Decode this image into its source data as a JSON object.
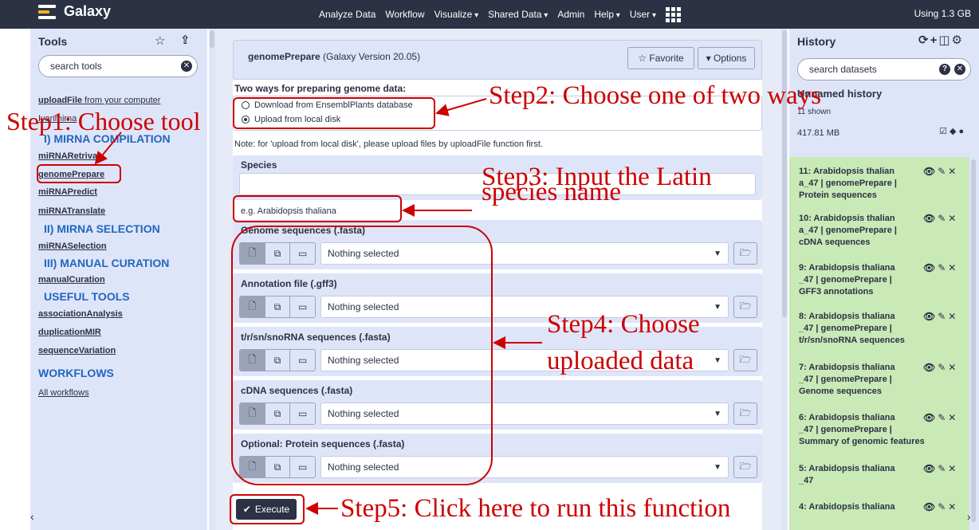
{
  "masthead": {
    "brand": "Galaxy",
    "nav": [
      "Analyze Data",
      "Workflow",
      "Visualize",
      "Shared Data",
      "Admin",
      "Help",
      "User"
    ],
    "quota": "Using 1.3 GB"
  },
  "tools_panel": {
    "title": "Tools",
    "search_placeholder": "search tools",
    "upload_link": "uploadFile",
    "upload_suffix": " from your computer",
    "group_title": "Ivanmirna",
    "sections": [
      {
        "title": "I) MIRNA COMPILATION",
        "tools": [
          "miRNARetrival",
          "genomePrepare",
          "miRNAPredict",
          "miRNATranslate"
        ]
      },
      {
        "title": "II) MIRNA SELECTION",
        "tools": [
          "miRNASelection"
        ]
      },
      {
        "title": "III) MANUAL CURATION",
        "tools": [
          "manualCuration"
        ]
      },
      {
        "title": "USEFUL TOOLS",
        "tools": [
          "associationAnalysis",
          "duplicationMIR",
          "sequenceVariation"
        ]
      }
    ],
    "workflows_title": "WORKFLOWS",
    "all_workflows": "All workflows"
  },
  "tool_form": {
    "tool_name": "genomePrepare",
    "tool_version": " (Galaxy Version 20.05)",
    "favorite_label": "Favorite",
    "options_label": "Options",
    "ways_label": "Two ways for preparing genome data:",
    "radio_options": [
      "Download from EnsemblPlants database",
      "Upload from local disk"
    ],
    "selected_radio": 1,
    "note": "Note: for 'upload from local disk', please upload files by uploadFile function first.",
    "species_label": "Species",
    "species_value": "",
    "species_help": "e.g. Arabidopsis thaliana",
    "datasets": [
      {
        "label": "Genome sequences (.fasta)",
        "value": "Nothing selected"
      },
      {
        "label": "Annotation file (.gff3)",
        "value": "Nothing selected"
      },
      {
        "label": "t/r/sn/snoRNA sequences (.fasta)",
        "value": "Nothing selected"
      },
      {
        "label": "cDNA sequences (.fasta)",
        "value": "Nothing selected"
      },
      {
        "label": "Optional: Protein sequences (.fasta)",
        "value": "Nothing selected"
      }
    ],
    "execute_label": "Execute"
  },
  "history": {
    "title": "History",
    "search_placeholder": "search datasets",
    "name": "Unnamed history",
    "shown": "11 shown",
    "size": "417.81 MB",
    "datasets": [
      {
        "line1": "11: Arabidopsis thalian",
        "line2": "a_47 | genomePrepare |",
        "line3": "Protein sequences"
      },
      {
        "line1": "10: Arabidopsis thalian",
        "line2": "a_47 | genomePrepare |",
        "line3": "cDNA sequences"
      },
      {
        "line1": "9: Arabidopsis thaliana",
        "line2": "_47 | genomePrepare |",
        "line3": "GFF3 annotations"
      },
      {
        "line1": "8: Arabidopsis thaliana",
        "line2": "_47 | genomePrepare |",
        "line3": "t/r/sn/snoRNA sequences"
      },
      {
        "line1": "7: Arabidopsis thaliana",
        "line2": "_47 | genomePrepare |",
        "line3": "Genome sequences"
      },
      {
        "line1": "6: Arabidopsis thaliana",
        "line2": "_47 | genomePrepare |",
        "line3": "Summary of genomic features"
      },
      {
        "line1": "5: Arabidopsis thaliana",
        "line2": "_47",
        "line3": ""
      },
      {
        "line1": "4: Arabidopsis thaliana",
        "line2": "",
        "line3": ""
      }
    ]
  },
  "annotations": {
    "step1": "Step1: Choose tool",
    "step2": "Step2: Choose one of two ways",
    "step3_line1": "Step3: Input the Latin",
    "step3_line2": "species name",
    "step4_line1": "Step4: Choose",
    "step4_line2": "uploaded data",
    "step5": "Step5: Click here to run this function"
  },
  "colors": {
    "masthead": "#2c3143",
    "panel": "#dfe5f9",
    "section": "#2066c0",
    "dataset_ok": "#c9e9b6",
    "annotation": "#cc0000"
  }
}
